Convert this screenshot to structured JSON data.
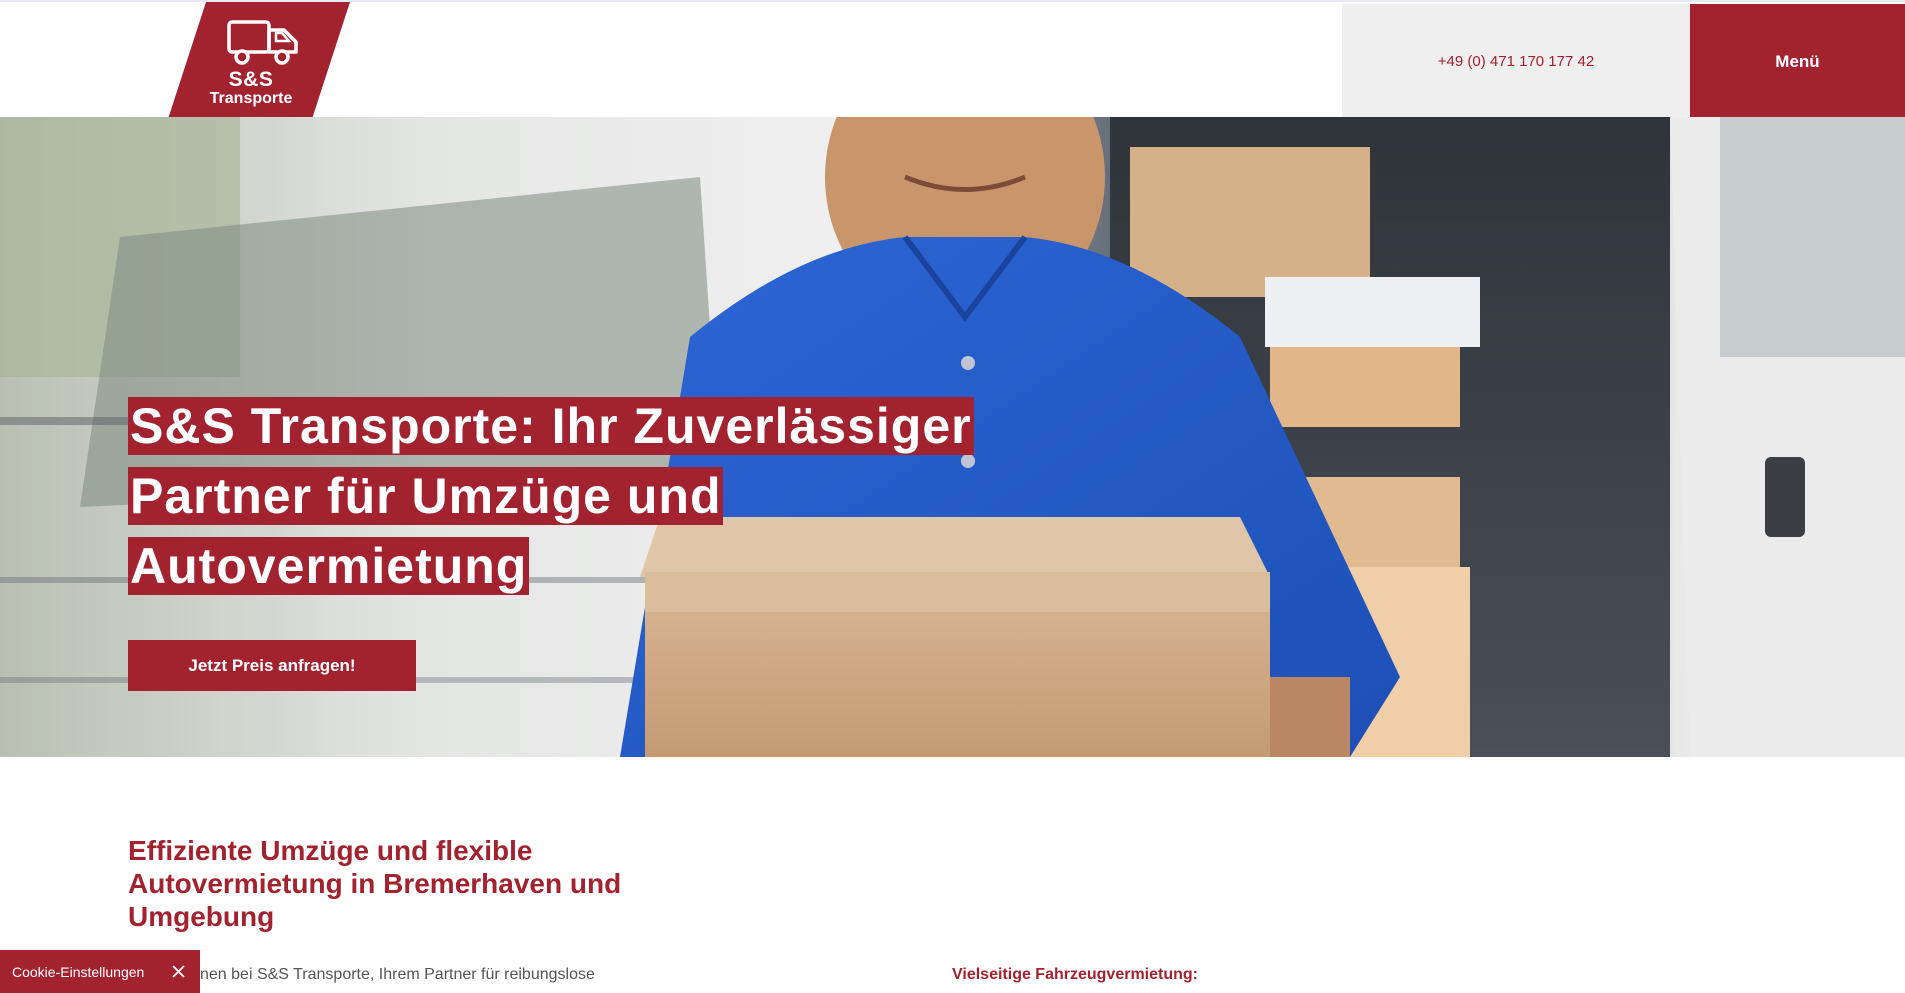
{
  "header": {
    "logo": {
      "line1": "S&S",
      "line2": "Transporte"
    },
    "phone": "+49 (0) 471 170 177 42",
    "menu_label": "Menü"
  },
  "hero": {
    "title_lines": [
      "S&S Transporte: Ihr Zuverlässiger",
      "Partner für Umzüge und",
      "Autovermietung"
    ],
    "cta_label": "Jetzt Preis anfragen!"
  },
  "content": {
    "heading": "Effiziente Umzüge und flexible Autovermietung in Bremerhaven und Umgebung",
    "intro_text": "nen bei S&S Transporte, Ihrem Partner für reibungslose",
    "sub_heading": "Vielseitige Fahrzeugvermietung:"
  },
  "cookie": {
    "label": "Cookie-Einstellungen"
  },
  "colors": {
    "brand_red": "#a3222f",
    "phone_bg": "#efefef",
    "text_gray": "#555555"
  },
  "icons": {
    "logo_icon": "delivery-truck-icon",
    "cookie_close": "close-icon"
  }
}
